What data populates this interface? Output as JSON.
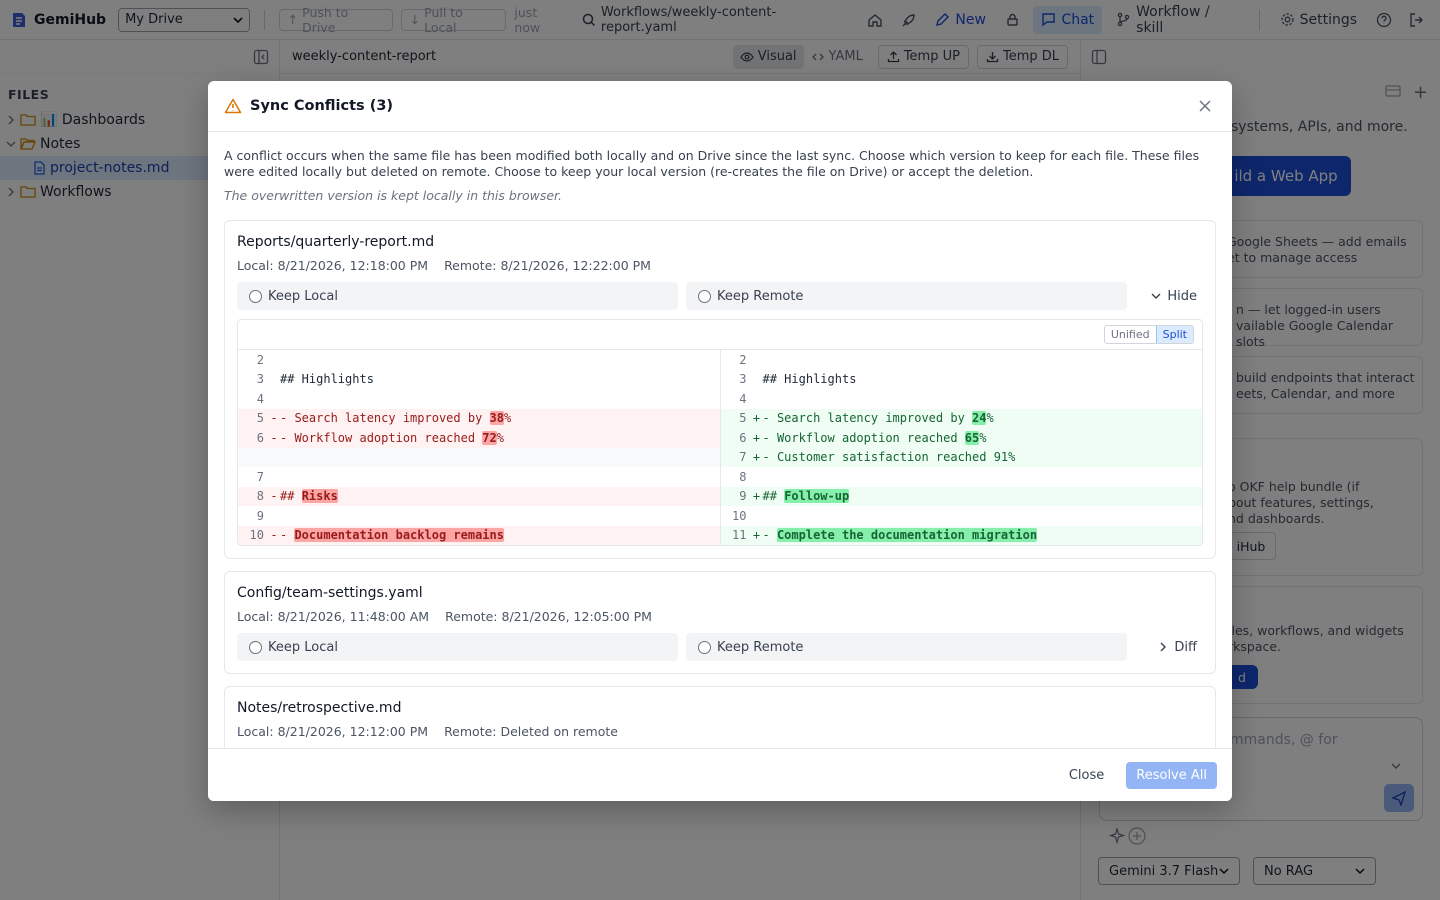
{
  "app": {
    "name": "GemiHub",
    "drive_select": "My Drive",
    "push_label": "Push to Drive",
    "pull_label": "Pull to Local",
    "sync_time": "just now",
    "current_path": "Workflows/weekly-content-report.yaml",
    "new_label": "New",
    "chat_label": "Chat",
    "workflow_label": "Workflow / skill",
    "settings_label": "Settings"
  },
  "sidebar": {
    "title": "FILES",
    "items": [
      {
        "label": "📊 Dashboards"
      },
      {
        "label": "Notes"
      },
      {
        "label": "project-notes.md"
      },
      {
        "label": "Workflows"
      }
    ]
  },
  "editor": {
    "file_name": "weekly-content-report",
    "visual_label": "Visual",
    "yaml_label": "YAML",
    "temp_up_label": "Temp UP",
    "temp_dl_label": "Temp DL"
  },
  "right_panel": {
    "t1": "systems, APIs, and more.",
    "btn1": "ild a Web App",
    "c1a": "Google Sheets — add emails",
    "c1b": "et to manage access",
    "c2a": "n — let logged-in users",
    "c2b": "vailable Google Calendar slots",
    "c3a": "build endpoints that interact",
    "c3b": "eets, Calendar, and more",
    "c4a": "o OKF help bundle (if",
    "c4b": "bout features, settings,",
    "c4c": "nd dashboards.",
    "c4btn": "iHub",
    "c5a": "iles, workflows, and widgets",
    "c5b": "rkspace.",
    "c5btn": "d",
    "input_placeholder": "mmands, @ for",
    "model_select": "Gemini 3.7 Flash",
    "rag_select": "No RAG"
  },
  "modal": {
    "title": "Sync Conflicts (3)",
    "description": "A conflict occurs when the same file has been modified both locally and on Drive since the last sync. Choose which version to keep for each file. These files were edited locally but deleted on remote. Choose to keep your local version (re-creates the file on Drive) or accept the deletion.",
    "note": "The overwritten version is kept locally in this browser.",
    "keep_local": "Keep Local",
    "keep_remote": "Keep Remote",
    "hide_label": "Hide",
    "diff_label": "Diff",
    "unified_label": "Unified",
    "split_label": "Split",
    "close_label": "Close",
    "resolve_all_label": "Resolve All",
    "conflicts": [
      {
        "file": "Reports/quarterly-report.md",
        "local": "Local: 8/21/2026, 12:18:00 PM",
        "remote": "Remote: 8/21/2026, 12:22:00 PM"
      },
      {
        "file": "Config/team-settings.yaml",
        "local": "Local: 8/21/2026, 11:48:00 AM",
        "remote": "Remote: 8/21/2026, 12:05:00 PM"
      },
      {
        "file": "Notes/retrospective.md",
        "local": "Local: 8/21/2026, 12:12:00 PM",
        "remote": "Remote: Deleted on remote"
      }
    ],
    "diff": {
      "left": [
        {
          "n": "2",
          "s": "",
          "a": "",
          "h": "",
          "b": "",
          "t": "ctx"
        },
        {
          "n": "3",
          "s": "",
          "a": "## Highlights",
          "h": "",
          "b": "",
          "t": "ctx"
        },
        {
          "n": "4",
          "s": "",
          "a": "",
          "h": "",
          "b": "",
          "t": "ctx"
        },
        {
          "n": "5",
          "s": "-",
          "a": "- Search latency improved by ",
          "h": "38",
          "b": "%",
          "t": "del"
        },
        {
          "n": "6",
          "s": "-",
          "a": "- Workflow adoption reached ",
          "h": "72",
          "b": "%",
          "t": "del"
        },
        {
          "n": "",
          "s": "",
          "a": "",
          "h": "",
          "b": "",
          "t": "empty"
        },
        {
          "n": "7",
          "s": "",
          "a": "",
          "h": "",
          "b": "",
          "t": "ctx"
        },
        {
          "n": "8",
          "s": "-",
          "a": "## ",
          "h": "Risks",
          "b": "",
          "t": "del"
        },
        {
          "n": "9",
          "s": "",
          "a": "",
          "h": "",
          "b": "",
          "t": "ctx"
        },
        {
          "n": "10",
          "s": "-",
          "a": "- ",
          "h": "Documentation backlog remains",
          "b": "",
          "t": "del"
        }
      ],
      "right": [
        {
          "n": "2",
          "s": "",
          "a": "",
          "h": "",
          "b": "",
          "t": "ctx"
        },
        {
          "n": "3",
          "s": "",
          "a": "## Highlights",
          "h": "",
          "b": "",
          "t": "ctx"
        },
        {
          "n": "4",
          "s": "",
          "a": "",
          "h": "",
          "b": "",
          "t": "ctx"
        },
        {
          "n": "5",
          "s": "+",
          "a": "- Search latency improved by ",
          "h": "24",
          "b": "%",
          "t": "add"
        },
        {
          "n": "6",
          "s": "+",
          "a": "- Workflow adoption reached ",
          "h": "65",
          "b": "%",
          "t": "add"
        },
        {
          "n": "7",
          "s": "+",
          "a": "- Customer satisfaction reached 91%",
          "h": "",
          "b": "",
          "t": "add"
        },
        {
          "n": "8",
          "s": "",
          "a": "",
          "h": "",
          "b": "",
          "t": "ctx"
        },
        {
          "n": "9",
          "s": "+",
          "a": "## ",
          "h": "Follow-up",
          "b": "",
          "t": "add"
        },
        {
          "n": "10",
          "s": "",
          "a": "",
          "h": "",
          "b": "",
          "t": "ctx"
        },
        {
          "n": "11",
          "s": "+",
          "a": "- ",
          "h": "Complete the documentation migration",
          "b": "",
          "t": "add"
        }
      ]
    }
  }
}
